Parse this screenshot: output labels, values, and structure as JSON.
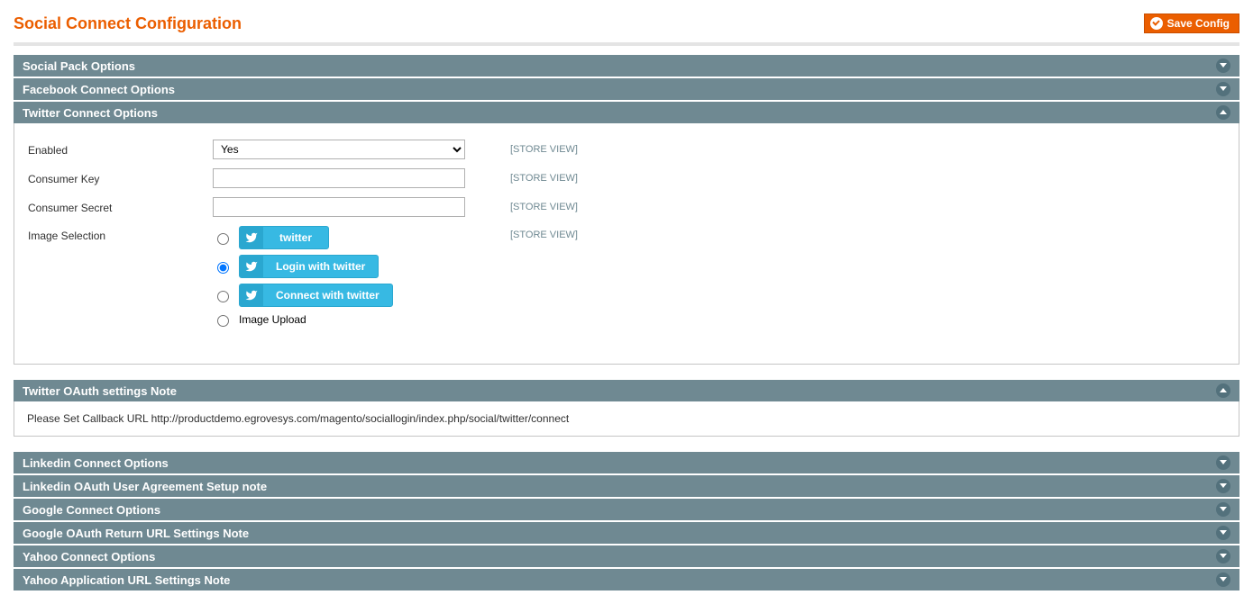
{
  "header": {
    "title": "Social Connect Configuration",
    "save_button": "Save Config"
  },
  "sections": {
    "social_pack": {
      "title": "Social Pack Options"
    },
    "facebook": {
      "title": "Facebook Connect Options"
    },
    "twitter": {
      "title": "Twitter Connect Options",
      "fields": {
        "enabled": {
          "label": "Enabled",
          "value": "Yes",
          "scope": "[STORE VIEW]"
        },
        "consumer_key": {
          "label": "Consumer Key",
          "value": "",
          "scope": "[STORE VIEW]"
        },
        "consumer_secret": {
          "label": "Consumer Secret",
          "value": "",
          "scope": "[STORE VIEW]"
        },
        "image_selection": {
          "label": "Image Selection",
          "scope": "[STORE VIEW]",
          "options": {
            "opt1": "twitter",
            "opt2": "Login with twitter",
            "opt3": "Connect with twitter",
            "opt4": "Image Upload"
          },
          "selected": "opt2"
        }
      }
    },
    "twitter_note": {
      "title": "Twitter OAuth settings Note",
      "text": "Please Set Callback URL http://productdemo.egrovesys.com/magento/sociallogin/index.php/social/twitter/connect"
    },
    "linkedin": {
      "title": "Linkedin Connect Options"
    },
    "linkedin_note": {
      "title": "Linkedin OAuth User Agreement Setup note"
    },
    "google": {
      "title": "Google Connect Options"
    },
    "google_note": {
      "title": "Google OAuth Return URL Settings Note"
    },
    "yahoo": {
      "title": "Yahoo Connect Options"
    },
    "yahoo_note": {
      "title": "Yahoo Application URL Settings Note"
    }
  }
}
